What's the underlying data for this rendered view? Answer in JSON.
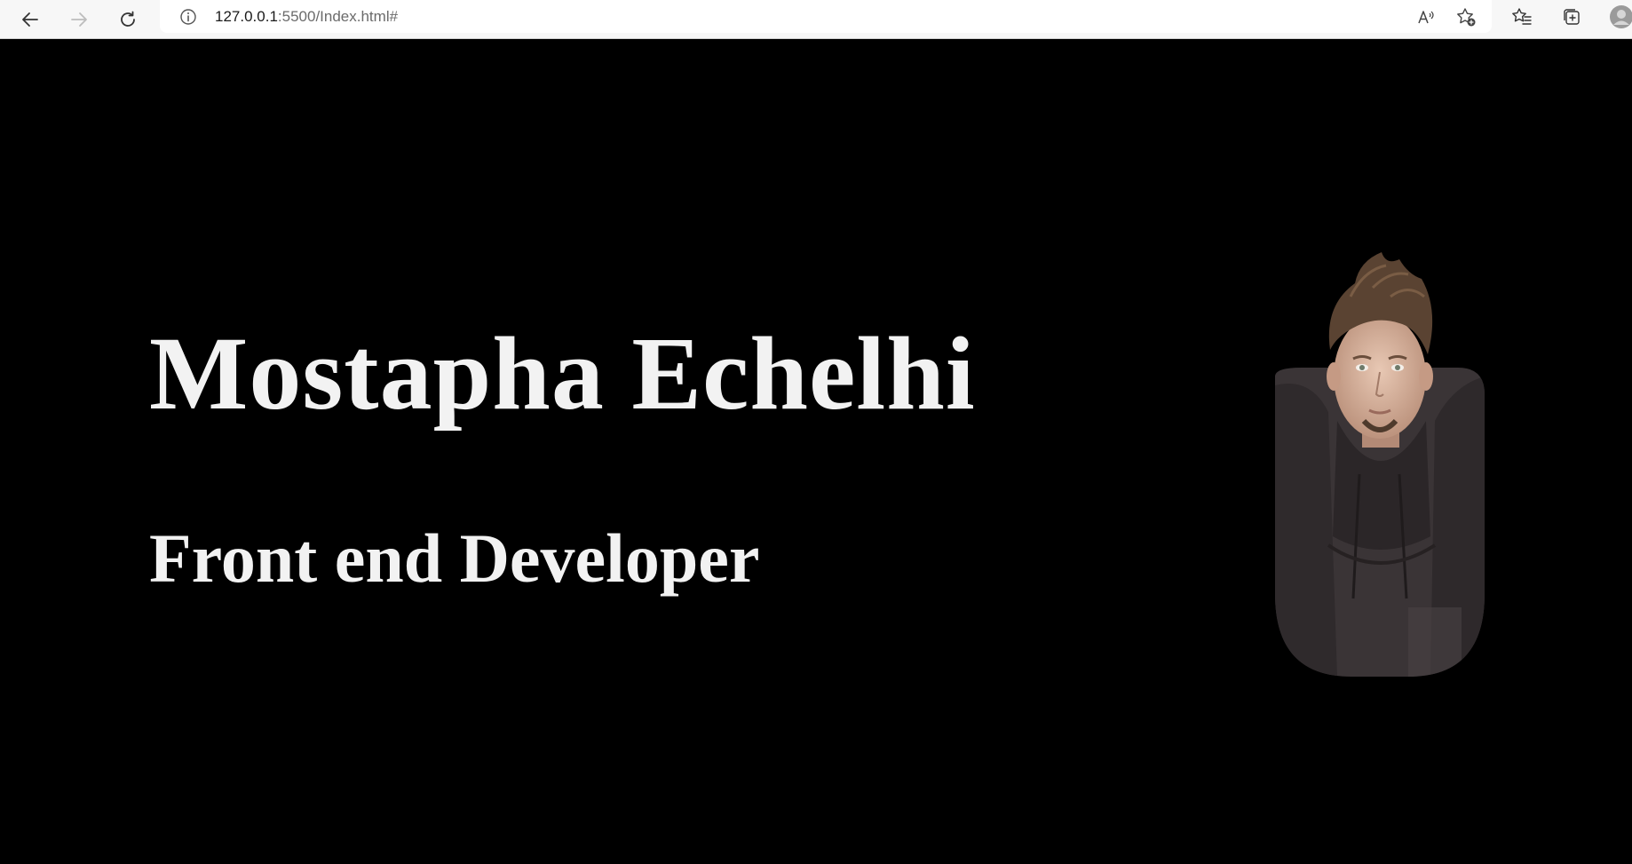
{
  "browser": {
    "url_host": "127.0.0.1",
    "url_rest": ":5500/Index.html#",
    "icons": {
      "back": "back-arrow-icon",
      "forward": "forward-arrow-icon",
      "reload": "reload-icon",
      "info": "info-icon",
      "read_aloud": "read-aloud-icon",
      "add_favorite": "add-favorite-icon",
      "favorites": "favorites-icon",
      "collections": "collections-icon",
      "profile": "profile-icon"
    }
  },
  "hero": {
    "name": "Mostapha Echelhi",
    "role": "Front end Developer"
  },
  "colors": {
    "page_background": "#000000",
    "text": "#f2f2f2"
  }
}
